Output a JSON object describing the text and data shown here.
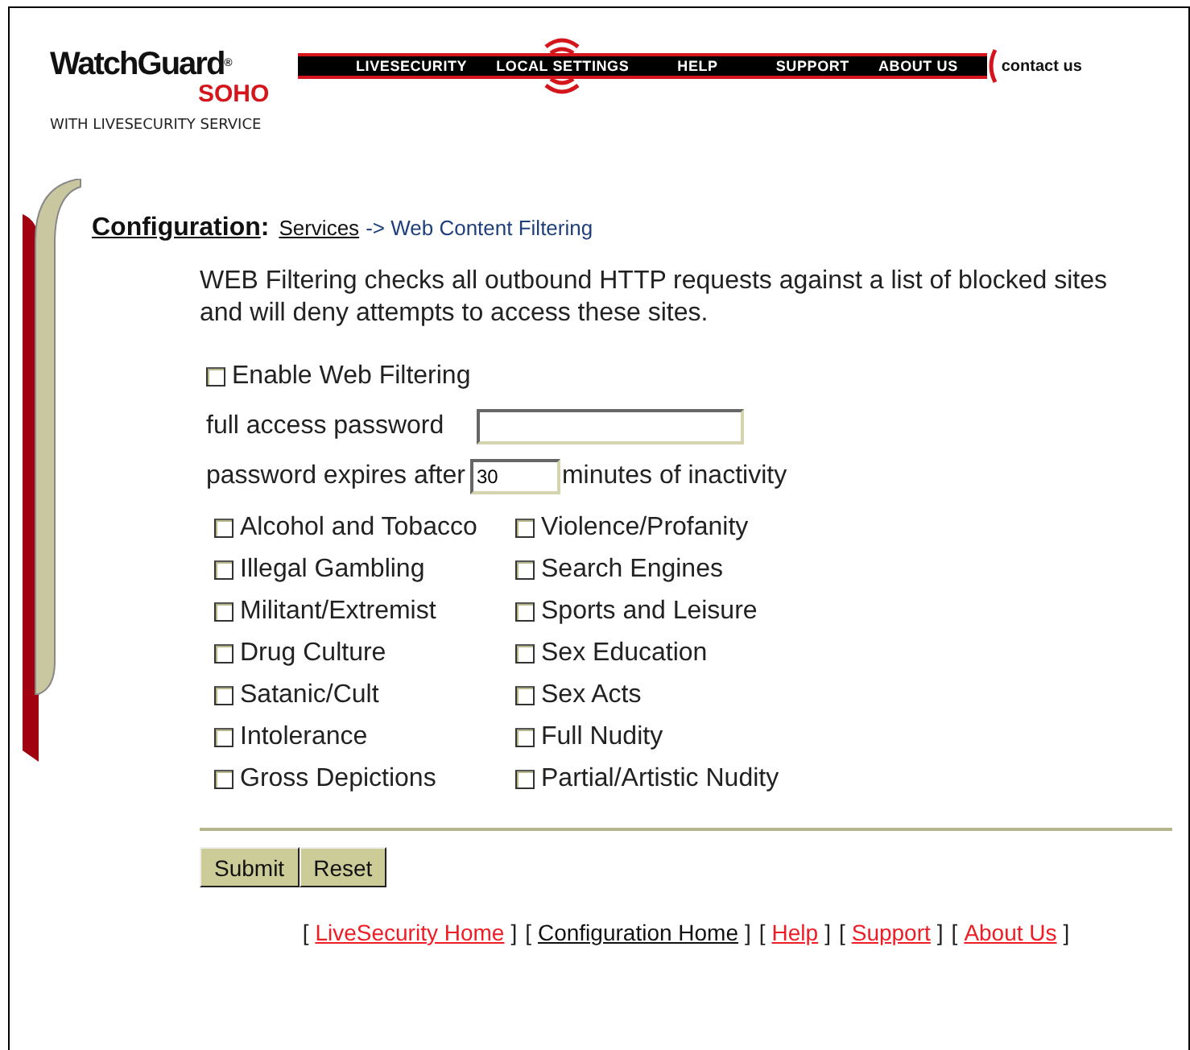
{
  "header": {
    "logo": {
      "brand": "WatchGuard$^{®}$",
      "product": "SOHO",
      "tagline": "WITH LIVESECURITY SERVICE"
    },
    "nav": [
      {
        "label": "LIVESECURITY",
        "selected": false
      },
      {
        "label": "LOCAL SETTINGS",
        "selected": true
      },
      {
        "label": "HELP",
        "selected": false
      },
      {
        "label": "SUPPORT",
        "selected": false
      },
      {
        "label": "ABOUT US",
        "selected": false
      }
    ],
    "contact": "contact us"
  },
  "breadcrumb": {
    "title": "Configuration",
    "colon": ":",
    "link": "Services",
    "trail": "-> Web Content Filtering"
  },
  "intro": "WEB Filtering checks all outbound HTTP requests against a list of blocked sites and will deny attempts to access these sites.",
  "enable": {
    "label": "Enable Web Filtering",
    "checked": false
  },
  "password": {
    "label": "full access password"
  },
  "expiry": {
    "label": "password expires after",
    "value": "30",
    "suffix": "minutes of inactivity"
  },
  "category_columns": [
    [
      {
        "label": "Alcohol and Tobacco",
        "checked": false
      },
      {
        "label": "Illegal Gambling",
        "checked": false
      },
      {
        "label": "Militant/Extremist",
        "checked": false
      },
      {
        "label": "Drug Culture",
        "checked": false
      },
      {
        "label": "Satanic/Cult",
        "checked": false
      },
      {
        "label": "Intolerance",
        "checked": false
      },
      {
        "label": "Gross Depictions",
        "checked": false
      }
    ],
    [
      {
        "label": "Violence/Profanity",
        "checked": false
      },
      {
        "label": "Search Engines",
        "checked": false
      },
      {
        "label": "Sports and Leisure",
        "checked": false
      },
      {
        "label": "Sex Education",
        "checked": false
      },
      {
        "label": "Sex Acts",
        "checked": false
      },
      {
        "label": "Full Nudity",
        "checked": false
      },
      {
        "label": "Partial/Artistic Nudity",
        "checked": false
      }
    ]
  ],
  "buttons": [
    "Submit",
    "Reset"
  ],
  "footer": [
    {
      "open": "[",
      "label": "LiveSecurity Home",
      "close": "]",
      "current": false
    },
    {
      "open": "[",
      "label": "Configuration Home",
      "close": "]",
      "current": true
    },
    {
      "open": "[",
      "label": "Help",
      "close": "]",
      "current": false
    },
    {
      "open": "[",
      "label": "Support",
      "close": "]",
      "current": false
    },
    {
      "open": "[",
      "label": "About Us",
      "close": "]",
      "current": false
    }
  ]
}
